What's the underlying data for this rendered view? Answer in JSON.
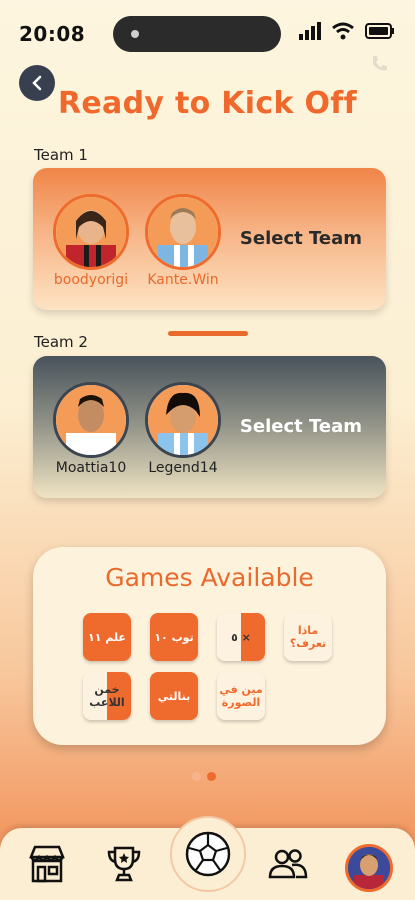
{
  "status": {
    "time": "20:08"
  },
  "header": {
    "title": "Ready to Kick Off"
  },
  "team1": {
    "label": "Team 1",
    "select_label": "Select Team",
    "players": [
      {
        "name": "boodyorigi"
      },
      {
        "name": "Kante.Win"
      }
    ]
  },
  "team2": {
    "label": "Team 2",
    "select_label": "Select Team",
    "players": [
      {
        "name": "Moattia10"
      },
      {
        "name": "Legend14"
      }
    ]
  },
  "games": {
    "title": "Games Available",
    "tiles": [
      {
        "text": "علم ١١",
        "icon": "eleven-flag-icon"
      },
      {
        "text": "توب ١٠",
        "icon": "top-ten-icon"
      },
      {
        "text": "٥ ×",
        "icon": "x-zero-icon"
      },
      {
        "text": "ماذا تعرف؟",
        "icon": "what-do-you-know-icon"
      },
      {
        "text": "خمن اللاعب",
        "icon": "guess-player-icon"
      },
      {
        "text": "بنالتي",
        "icon": "penalty-icon"
      },
      {
        "text": "مين في الصورة",
        "icon": "who-in-picture-icon"
      }
    ]
  },
  "pager": {
    "current_page": 2,
    "total_pages": 2
  },
  "colors": {
    "accent": "#ee6a2d",
    "dark": "#3b4550"
  },
  "nav": {
    "items": [
      "store-icon",
      "trophy-icon",
      "soccer-ball-icon",
      "friends-icon",
      "profile-avatar"
    ]
  }
}
